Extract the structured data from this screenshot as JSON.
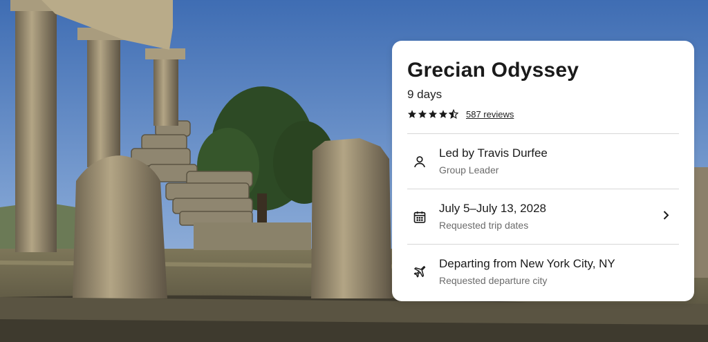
{
  "trip": {
    "title": "Grecian Odyssey",
    "duration": "9 days",
    "rating_stars": 4.5,
    "reviews_link": "587 reviews"
  },
  "details": [
    {
      "icon": "person-icon",
      "main": "Led by Travis Durfee",
      "sub": "Group Leader"
    },
    {
      "icon": "calendar-icon",
      "main": "July 5–July 13, 2028",
      "sub": "Requested trip dates"
    },
    {
      "icon": "airplane-icon",
      "main": "Departing from New York City, NY",
      "sub": "Requested departure city"
    }
  ],
  "colors": {
    "sky": "#5f86c2",
    "card": "#ffffff",
    "text": "#1a1a1a",
    "muted": "#6b6b6b"
  }
}
